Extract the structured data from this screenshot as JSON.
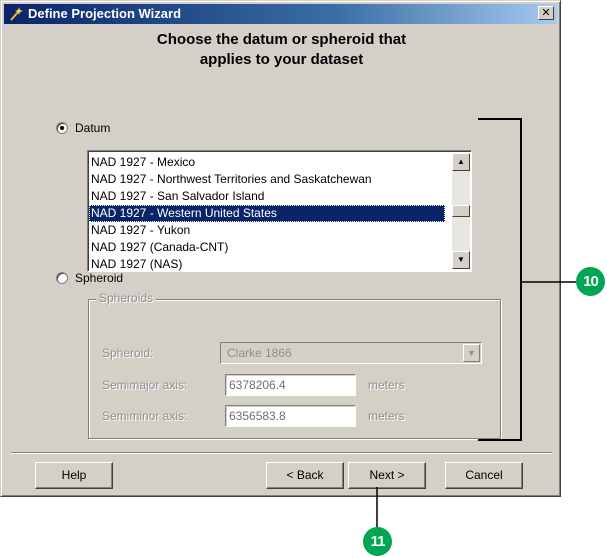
{
  "window": {
    "title": "Define Projection Wizard",
    "close_glyph": "✕"
  },
  "heading": {
    "line1": "Choose the datum or spheroid that",
    "line2": "applies to your dataset"
  },
  "datum": {
    "label": "Datum",
    "selected": true,
    "items": [
      "NAD 1927 - Mexico",
      "NAD 1927 - Northwest Territories and Saskatchewan",
      "NAD 1927 - San Salvador Island",
      "NAD 1927 - Western United States",
      "NAD 1927 - Yukon",
      "NAD 1927 (Canada-CNT)",
      "NAD 1927 (NAS)"
    ],
    "selected_item": "NAD 1927 - Western United States"
  },
  "spheroid": {
    "label": "Spheroid",
    "selected": false,
    "group_label": "Spheroids",
    "spheroid_label": "Spheroid:",
    "spheroid_value": "Clarke 1866",
    "semimajor_label": "Semimajor axis:",
    "semimajor_value": "6378206.4",
    "semimajor_unit": "meters",
    "semiminor_label": "Semiminor axis:",
    "semiminor_value": "6356583.8",
    "semiminor_unit": "meters"
  },
  "buttons": {
    "help": "Help",
    "back": "< Back",
    "next": "Next >",
    "cancel": "Cancel"
  },
  "callouts": {
    "list_callout": "10",
    "next_callout": "11",
    "color": "#00a651"
  }
}
